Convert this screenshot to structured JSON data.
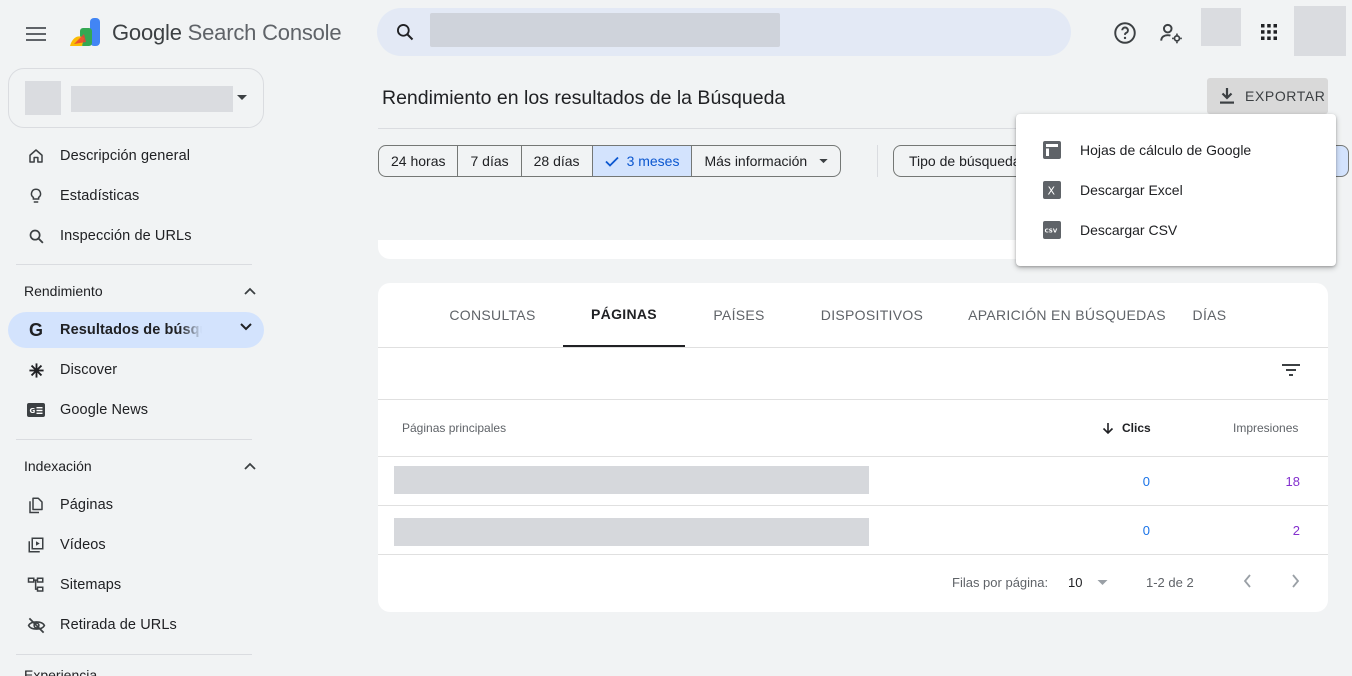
{
  "app": {
    "name_google": "Google",
    "name_rest": "Search Console"
  },
  "search": {
    "value": "",
    "placeholder": ""
  },
  "sidebar": {
    "general": [
      {
        "label": "Descripción general",
        "icon": "home-icon"
      },
      {
        "label": "Estadísticas",
        "icon": "lightbulb-icon"
      },
      {
        "label": "Inspección de URLs",
        "icon": "search-icon"
      }
    ],
    "rendimiento": {
      "header": "Rendimiento",
      "items": [
        {
          "label": "Resultados de búsqueda",
          "icon": "google-g-icon",
          "active": true
        },
        {
          "label": "Discover",
          "icon": "asterisk-icon"
        },
        {
          "label": "Google News",
          "icon": "news-icon"
        }
      ]
    },
    "indexacion": {
      "header": "Indexación",
      "items": [
        {
          "label": "Páginas",
          "icon": "pages-icon"
        },
        {
          "label": "Vídeos",
          "icon": "video-icon"
        },
        {
          "label": "Sitemaps",
          "icon": "sitemap-icon"
        },
        {
          "label": "Retirada de URLs",
          "icon": "eye-off-icon"
        }
      ]
    },
    "next_section": "Experiencia"
  },
  "main": {
    "title": "Rendimiento en los resultados de la Búsqueda",
    "export_label": "EXPORTAR",
    "ranges": [
      "24 horas",
      "7 días",
      "28 días",
      "3 meses",
      "Más información"
    ],
    "selected_range": "3 meses",
    "search_type_label": "Tipo de búsqueda"
  },
  "export_menu": {
    "items": [
      {
        "label": "Hojas de cálculo de Google",
        "icon": "sheets-icon"
      },
      {
        "label": "Descargar Excel",
        "icon": "excel-icon"
      },
      {
        "label": "Descargar CSV",
        "icon": "csv-icon"
      }
    ]
  },
  "tabs": [
    "CONSULTAS",
    "PÁGINAS",
    "PAÍSES",
    "DISPOSITIVOS",
    "APARICIÓN EN BÚSQUEDAS",
    "DÍAS"
  ],
  "active_tab": "PÁGINAS",
  "table": {
    "headers": {
      "pages": "Páginas principales",
      "clicks": "Clics",
      "impressions": "Impresiones"
    },
    "rows": [
      {
        "page": "",
        "clicks": "0",
        "impressions": "18"
      },
      {
        "page": "",
        "clicks": "0",
        "impressions": "2"
      }
    ],
    "pagination": {
      "rows_per_page_label": "Filas por página:",
      "rows_per_page": "10",
      "range": "1-2 de 2"
    }
  },
  "colors": {
    "accent_blue": "#1a73e8",
    "impressions_purple": "#8430ce",
    "selected_bg": "#d3e3fd"
  }
}
